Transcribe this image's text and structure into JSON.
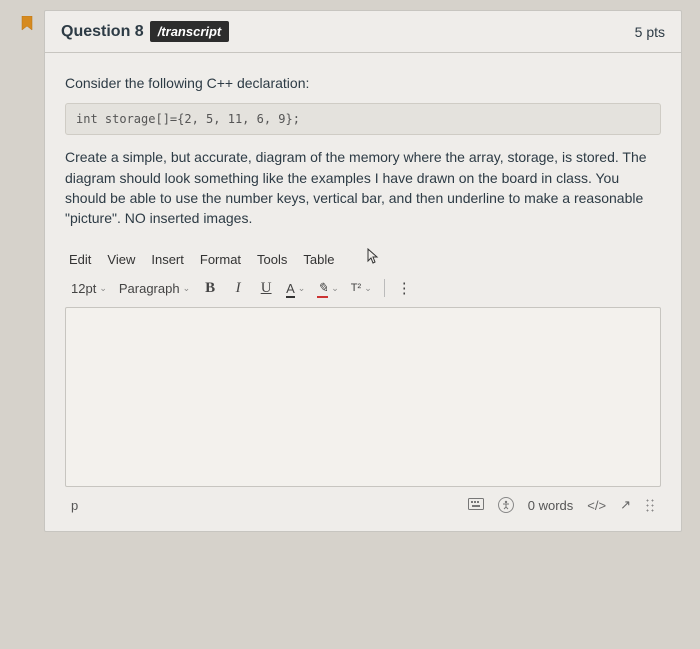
{
  "header": {
    "question_label": "Question 8",
    "chip": "/transcript",
    "points": "5 pts"
  },
  "prompt": {
    "intro": "Consider the following C++ declaration:",
    "code": "int storage[]={2, 5, 11, 6, 9};",
    "instructions": "Create a simple, but accurate, diagram of the memory where the array, storage, is stored. The diagram should look something like the examples I have drawn on the board in class. You should be able to use the number keys, vertical bar, and then underline to make a reasonable \"picture\". NO inserted images."
  },
  "editor": {
    "menu": {
      "edit": "Edit",
      "view": "View",
      "insert": "Insert",
      "format": "Format",
      "tools": "Tools",
      "table": "Table"
    },
    "toolbar": {
      "font_size": "12pt",
      "block_format": "Paragraph",
      "bold": "B",
      "italic": "I",
      "underline": "U",
      "text_color": "A",
      "highlight": "✎",
      "superscript": "T²",
      "more": "⋮"
    },
    "footer": {
      "path": "p",
      "word_count": "0 words",
      "html_view": "</>",
      "fullscreen": "↗"
    }
  }
}
